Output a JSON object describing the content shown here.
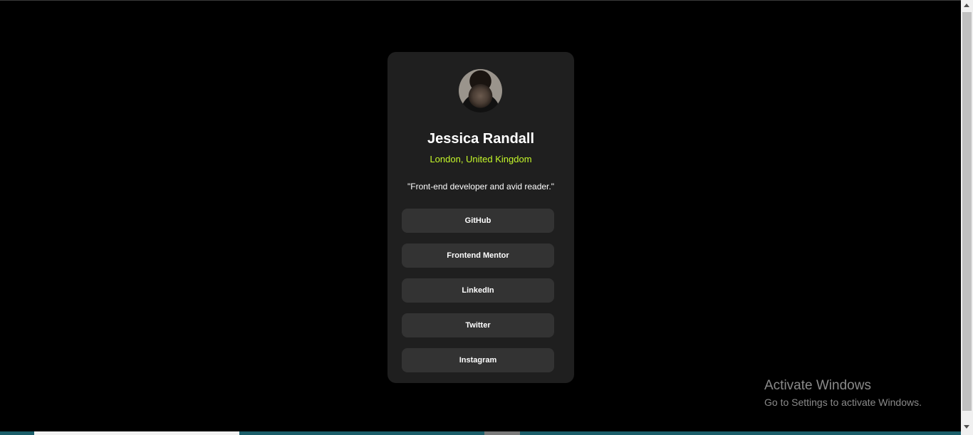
{
  "profile": {
    "name": "Jessica Randall",
    "location": "London, United Kingdom",
    "bio": "\"Front-end developer and avid reader.\""
  },
  "links": [
    {
      "label": "GitHub"
    },
    {
      "label": "Frontend Mentor"
    },
    {
      "label": "LinkedIn"
    },
    {
      "label": "Twitter"
    },
    {
      "label": "Instagram"
    }
  ],
  "watermark": {
    "title": "Activate Windows",
    "subtitle": "Go to Settings to activate Windows."
  },
  "colors": {
    "background": "#000000",
    "card": "#1f1f1f",
    "accent": "#c5f82a",
    "button": "#333333"
  }
}
